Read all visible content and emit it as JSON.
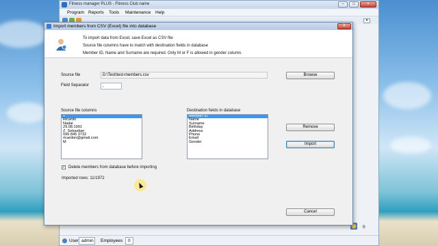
{
  "app": {
    "title": "Fitness manager PLUS - Fitness Club name",
    "menu": [
      "Program",
      "Reports",
      "Tools",
      "Maintenance",
      "Help"
    ],
    "status": {
      "user_label": "User",
      "user_value": "admin",
      "employees_label": "Employees",
      "employees_value": "0",
      "right_counter": "0"
    }
  },
  "dialog": {
    "title": "Import members from CSV (Excel) file into database",
    "close_label": "X",
    "info_lines": [
      "To import data from Excel, save Excel as CSV file",
      "Source file columns have to match with destination fields in database",
      "Member ID, Name and Surname are required.  Only M or F is allowed in gender column."
    ],
    "source_file_label": "Source file",
    "source_file_value": "D:\\Test\\test-members.csv",
    "field_separator_label": "Field Separator",
    "field_separator_value": ",",
    "browse_label": "Browse",
    "source_columns_label": "Source file columns",
    "source_columns": [
      "1",
      "Ricardo",
      "Nadal",
      "29.08.1991",
      "Z. Sebastian",
      "095 845 3732",
      "ricardon@gmail.com",
      "M"
    ],
    "destination_label": "Destination fields in database",
    "destination_fields": [
      "Member ID",
      "Name",
      "Surname",
      "Birthday",
      "Address",
      "Phone",
      "Email",
      "Gender"
    ],
    "remove_label": "Remove",
    "import_label": "Import",
    "delete_checkbox_label": "Delete members from database before importing",
    "delete_checkbox_checked": true,
    "imported_rows": "Imported rows: 11/1972",
    "cancel_label": "Cancel"
  },
  "colors": {
    "selection": "#3399ff",
    "title_bar": "#c6d6ea"
  }
}
